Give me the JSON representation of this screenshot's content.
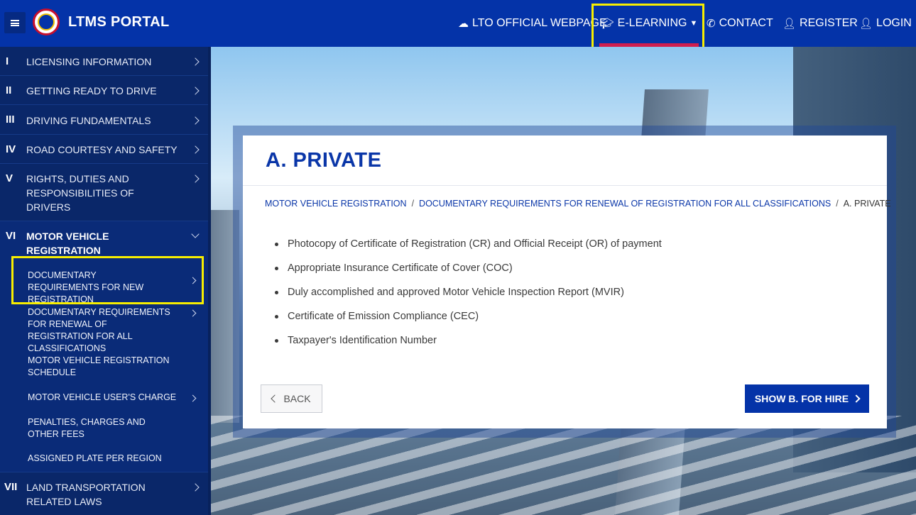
{
  "header": {
    "brand": "LTMS PORTAL",
    "nav": {
      "lto": "LTO OFFICIAL WEBPAGE",
      "elearning": "E-LEARNING",
      "contact": "CONTACT",
      "register": "REGISTER",
      "login": "LOGIN"
    },
    "accent_color": "#d01e4f"
  },
  "sidebar": {
    "items": [
      {
        "num": "I",
        "label": "LICENSING INFORMATION"
      },
      {
        "num": "II",
        "label": "GETTING READY TO DRIVE"
      },
      {
        "num": "III",
        "label": "DRIVING FUNDAMENTALS"
      },
      {
        "num": "IV",
        "label": "ROAD COURTESY AND SAFETY"
      },
      {
        "num": "V",
        "label": "RIGHTS, DUTIES AND RESPONSIBILITIES OF DRIVERS"
      },
      {
        "num": "VI",
        "label": "MOTOR VEHICLE REGISTRATION"
      },
      {
        "num": "VII",
        "label": "LAND TRANSPORTATION RELATED LAWS"
      }
    ],
    "subitems": [
      {
        "label": "DOCUMENTARY REQUIREMENTS FOR NEW REGISTRATION"
      },
      {
        "label": "DOCUMENTARY REQUIREMENTS FOR RENEWAL OF REGISTRATION FOR ALL CLASSIFICATIONS"
      },
      {
        "label": "MOTOR VEHICLE REGISTRATION SCHEDULE"
      },
      {
        "label": "MOTOR VEHICLE USER'S CHARGE"
      },
      {
        "label": "PENALTIES, CHARGES AND OTHER FEES"
      },
      {
        "label": "ASSIGNED PLATE PER REGION"
      }
    ]
  },
  "main": {
    "title": "A. PRIVATE",
    "breadcrumb": [
      "MOTOR VEHICLE REGISTRATION",
      "DOCUMENTARY REQUIREMENTS FOR RENEWAL OF REGISTRATION FOR ALL CLASSIFICATIONS",
      "A. PRIVATE"
    ],
    "requirements": [
      "Photocopy of Certificate of Registration (CR) and Official Receipt (OR) of payment",
      "Appropriate Insurance Certificate of Cover (COC)",
      "Duly accomplished and approved Motor Vehicle Inspection Report (MVIR)",
      "Certificate of Emission Compliance (CEC)",
      "Taxpayer's Identification Number"
    ],
    "back_label": "BACK",
    "next_label": "SHOW B. FOR HIRE"
  }
}
